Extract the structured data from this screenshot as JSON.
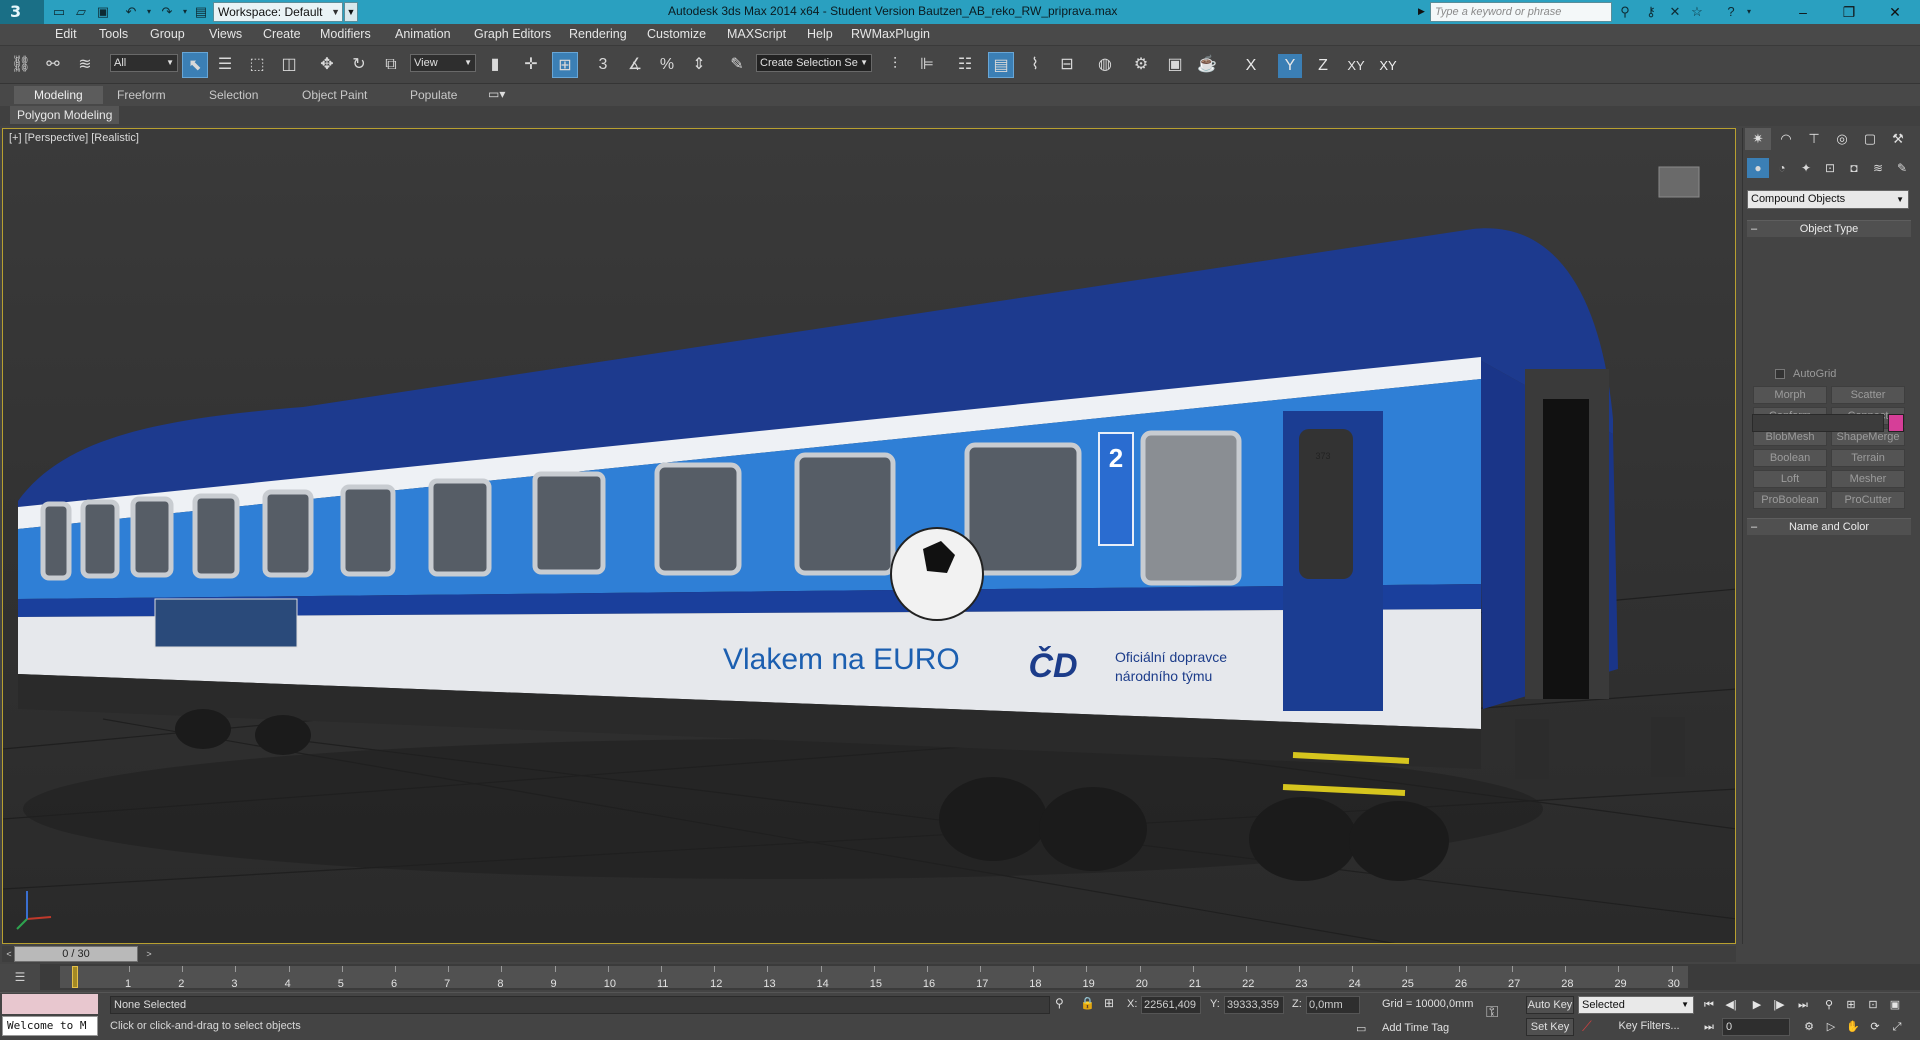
{
  "app": {
    "title": "Autodesk 3ds Max  2014 x64  - Student Version   Bautzen_AB_reko_RW_priprava.max",
    "workspace": "Workspace: Default",
    "search_placeholder": "Type a keyword or phrase",
    "logo": "3"
  },
  "window_controls": {
    "minimize": "–",
    "restore": "❐",
    "close": "✕"
  },
  "menu": [
    "Edit",
    "Tools",
    "Group",
    "Views",
    "Create",
    "Modifiers",
    "Animation",
    "Graph Editors",
    "Rendering",
    "Customize",
    "MAXScript",
    "Help",
    "RWMaxPlugin"
  ],
  "toolbar": {
    "filter": "All",
    "ref_coord": "View",
    "named_selection": "Create Selection Se",
    "snap_label": "3",
    "percent_label": "%",
    "axes": [
      "X",
      "Y",
      "Z",
      "XY",
      "XY"
    ]
  },
  "ribbon": {
    "tabs": [
      "Modeling",
      "Freeform",
      "Selection",
      "Object Paint",
      "Populate"
    ],
    "active_tab": "Modeling",
    "panel": "Polygon Modeling"
  },
  "viewport": {
    "label": "[+] [Perspective] [Realistic]",
    "train": {
      "brand_text": "Vlakem na EURO",
      "logo_text": "ČD",
      "partner_text_1": "Oficiální dopravce",
      "partner_text_2": "národního týmu",
      "class_number": "2",
      "door_sign": "373"
    }
  },
  "command_panel": {
    "dropdown": "Compound Objects",
    "object_type_title": "Object Type",
    "autogrid": "AutoGrid",
    "buttons": [
      "Morph",
      "Scatter",
      "Conform",
      "Connect",
      "BlobMesh",
      "ShapeMerge",
      "Boolean",
      "Terrain",
      "Loft",
      "Mesher",
      "ProBoolean",
      "ProCutter"
    ],
    "name_color_title": "Name and Color",
    "collapse": "–"
  },
  "timeline": {
    "slider": "0 / 30",
    "ticks": [
      "1",
      "2",
      "3",
      "4",
      "5",
      "6",
      "7",
      "8",
      "9",
      "10",
      "11",
      "12",
      "13",
      "14",
      "15",
      "16",
      "17",
      "18",
      "19",
      "20",
      "21",
      "22",
      "23",
      "24",
      "25",
      "26",
      "27",
      "28",
      "29",
      "30"
    ]
  },
  "status": {
    "maxscript": "Welcome to M",
    "selection": "None Selected",
    "prompt": "Click or click-and-drag to select objects",
    "x_label": "X:",
    "x_value": "22561,409",
    "y_label": "Y:",
    "y_value": "39333,359",
    "z_label": "Z:",
    "z_value": "0,0mm",
    "grid": "Grid = 10000,0mm",
    "add_time_tag": "Add Time Tag",
    "auto_key": "Auto Key",
    "set_key": "Set Key",
    "selection_set": "Selected",
    "key_filters": "Key Filters...",
    "frame": "0"
  }
}
